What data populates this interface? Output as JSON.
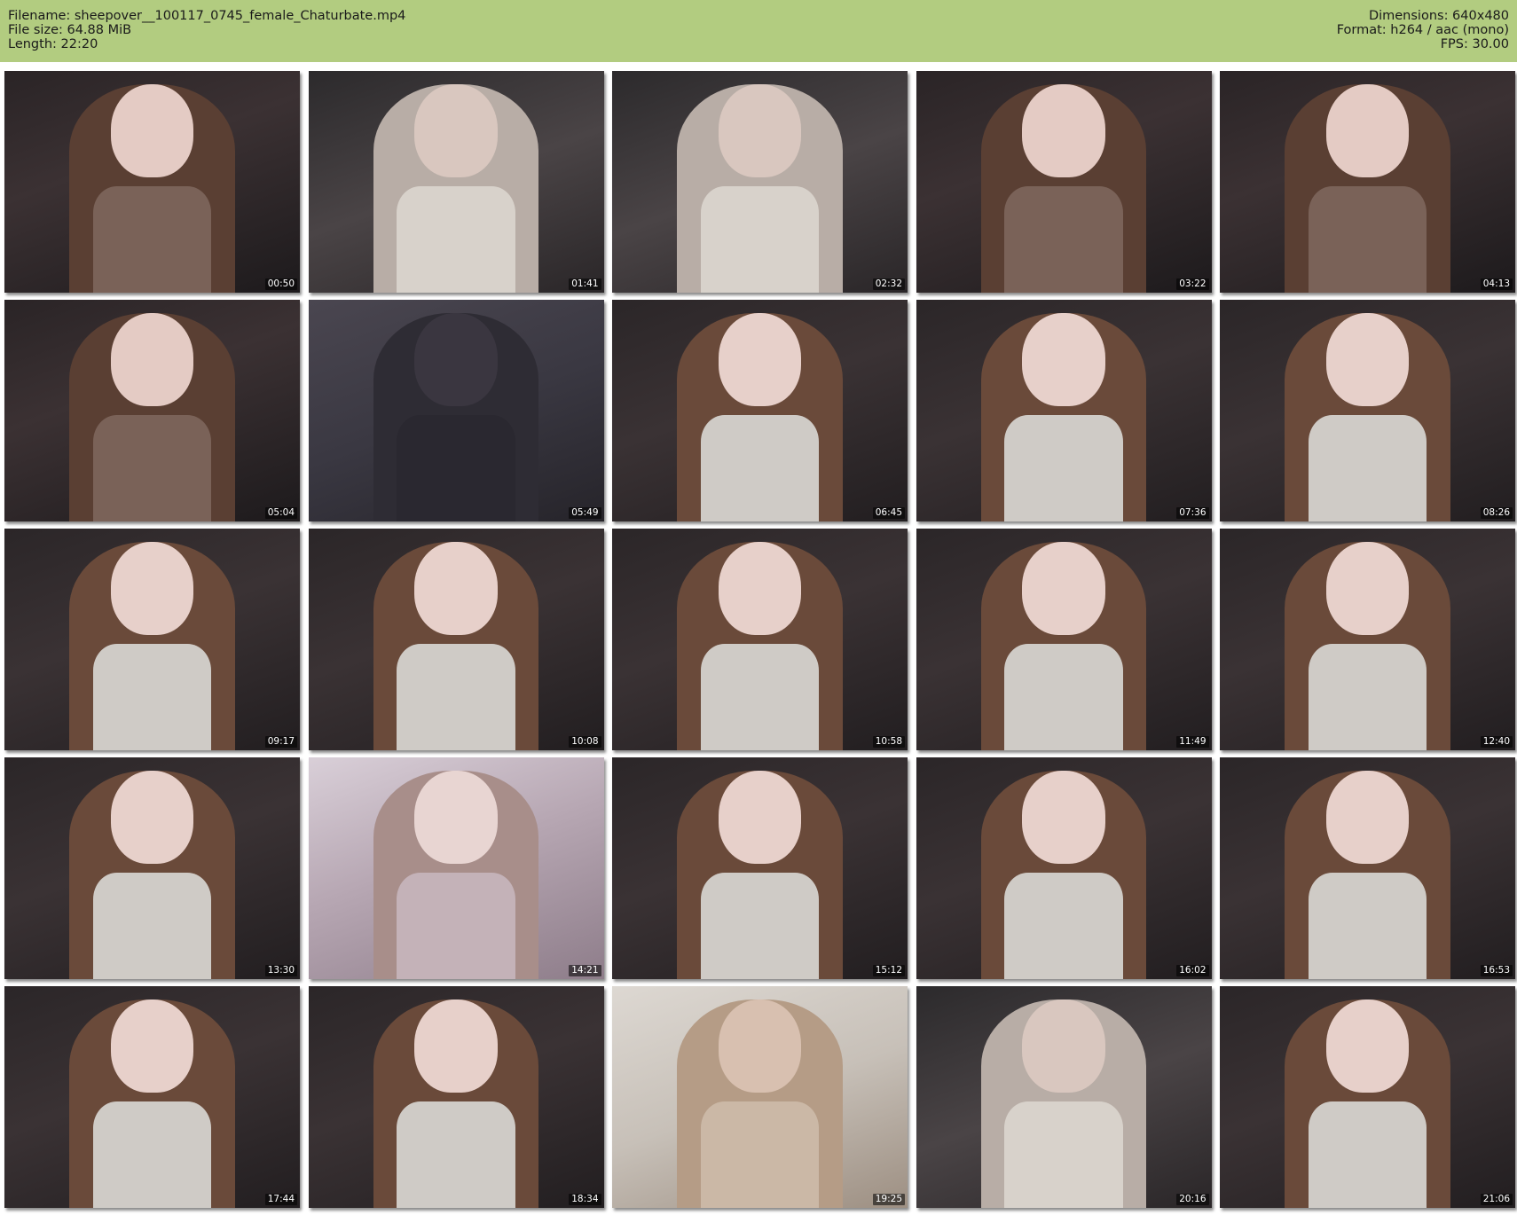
{
  "file_info": {
    "filename_line": "Filename: sheepover__100117_0745_female_Chaturbate.mp4",
    "filesize_line": "File size: 64.88 MiB",
    "length_line": "Length: 22:20",
    "dimensions_line": "Dimensions: 640x480",
    "format_line": "Format: h264 / aac (mono)",
    "fps_line": "FPS: 30.00"
  },
  "colors": {
    "header_bg": "#b2cc80",
    "page_bg": "#ffffff"
  },
  "thumbnails": [
    {
      "timestamp": "00:50",
      "scene": "portrait-dark"
    },
    {
      "timestamp": "01:41",
      "scene": "closeup-dress"
    },
    {
      "timestamp": "02:32",
      "scene": "closeup-dress"
    },
    {
      "timestamp": "03:22",
      "scene": "portrait-dark"
    },
    {
      "timestamp": "04:13",
      "scene": "portrait-dark"
    },
    {
      "timestamp": "05:04",
      "scene": "portrait-dark"
    },
    {
      "timestamp": "05:49",
      "scene": "empty-room"
    },
    {
      "timestamp": "06:45",
      "scene": "portrait-dress"
    },
    {
      "timestamp": "07:36",
      "scene": "portrait-dress"
    },
    {
      "timestamp": "08:26",
      "scene": "portrait-dress"
    },
    {
      "timestamp": "09:17",
      "scene": "portrait-dress"
    },
    {
      "timestamp": "10:08",
      "scene": "portrait-dress"
    },
    {
      "timestamp": "10:58",
      "scene": "portrait-dress"
    },
    {
      "timestamp": "11:49",
      "scene": "portrait-dress"
    },
    {
      "timestamp": "12:40",
      "scene": "portrait-dress"
    },
    {
      "timestamp": "13:30",
      "scene": "portrait-dress"
    },
    {
      "timestamp": "14:21",
      "scene": "blurred-closeup"
    },
    {
      "timestamp": "15:12",
      "scene": "portrait-dress"
    },
    {
      "timestamp": "16:02",
      "scene": "portrait-dress"
    },
    {
      "timestamp": "16:53",
      "scene": "portrait-dress"
    },
    {
      "timestamp": "17:44",
      "scene": "portrait-dress"
    },
    {
      "timestamp": "18:34",
      "scene": "portrait-dress"
    },
    {
      "timestamp": "19:25",
      "scene": "full-body-room"
    },
    {
      "timestamp": "20:16",
      "scene": "closeup-dress"
    },
    {
      "timestamp": "21:06",
      "scene": "portrait-dress"
    }
  ]
}
